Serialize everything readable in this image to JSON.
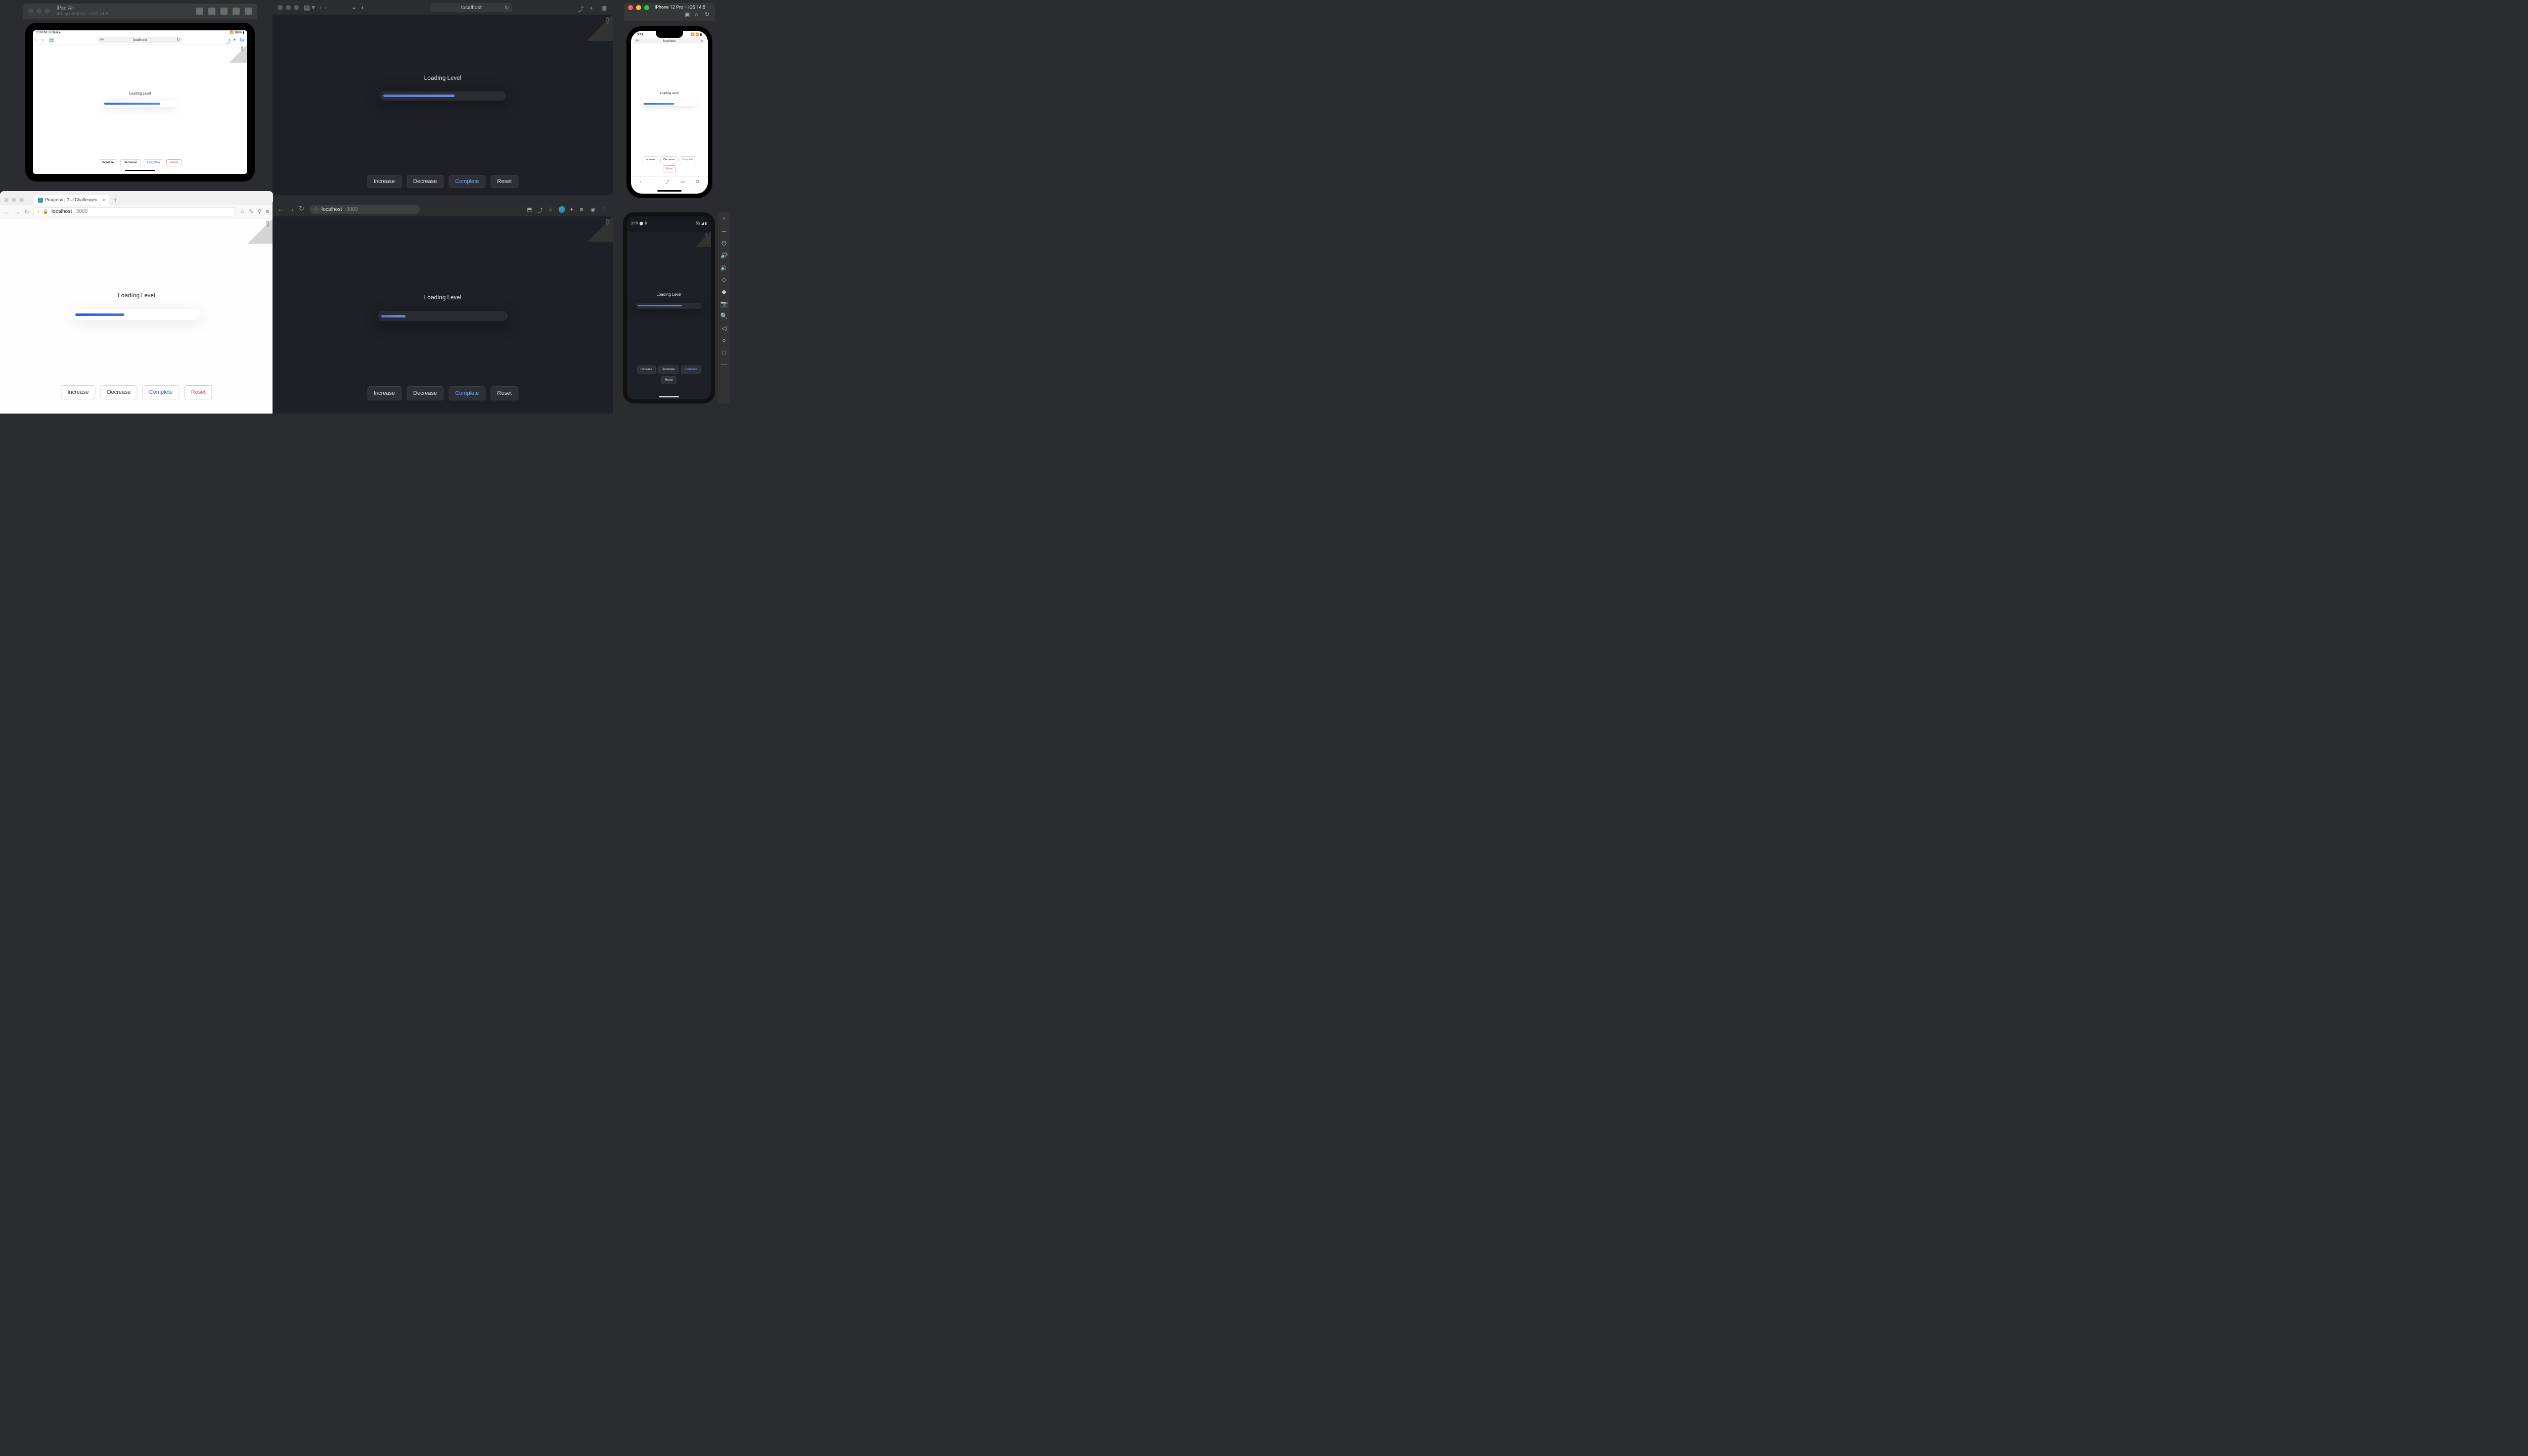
{
  "app": {
    "loading_label": "Loading Level",
    "buttons": {
      "increase": "Increase",
      "decrease": "Decrease",
      "complete": "Complete",
      "reset": "Reset"
    },
    "colors": {
      "accent_blue": "#2a6cf0",
      "accent_red": "#e84a3a",
      "dark_accent_blue": "#7aa3f5"
    }
  },
  "ipad_sim": {
    "title": "iPad Air",
    "subtitle": "4th generation – iOS 14.5",
    "status": {
      "time": "3:19 PM",
      "date": "Fri Mar 4",
      "battery": "100%"
    },
    "url": "localhost",
    "aa": "AA",
    "progress_pct": 78
  },
  "safari": {
    "url": "localhost",
    "progress_pct": 60
  },
  "iphone_sim": {
    "title": "iPhone 12 Pro – iOS 14.5",
    "status": {
      "time": "3:19"
    },
    "url": "localhost",
    "aa": "AA",
    "progress_pct": 60
  },
  "firefox": {
    "tab_title": "Progress | GUI Challenges",
    "url_host": "localhost",
    "url_port": ":3000",
    "progress_pct": 40
  },
  "chrome": {
    "url_host": "localhost",
    "url_port": ":3000",
    "progress_pct": 20
  },
  "android": {
    "status": {
      "time": "3:19",
      "notif": "8"
    },
    "progress_pct": 70
  },
  "icons": {
    "back": "‹",
    "forward": "›",
    "reload": "↻",
    "share": "⤴",
    "plus": "+",
    "tabs": "⧉",
    "sidebar": "▤",
    "star": "☆",
    "menu": "≡",
    "shield": "◒",
    "info": "ⓘ",
    "download": "⬇",
    "ext": "✦",
    "book": "▭",
    "power": "⏻",
    "vol_up": "🔊",
    "vol_down": "🔉",
    "rotate_l": "◇",
    "rotate_r": "◆",
    "camera": "📷",
    "zoom": "🔍",
    "tri": "◁",
    "circ": "○",
    "sq": "□",
    "more": "⋯",
    "pin": "📌",
    "close": "×",
    "home": "⌂"
  }
}
